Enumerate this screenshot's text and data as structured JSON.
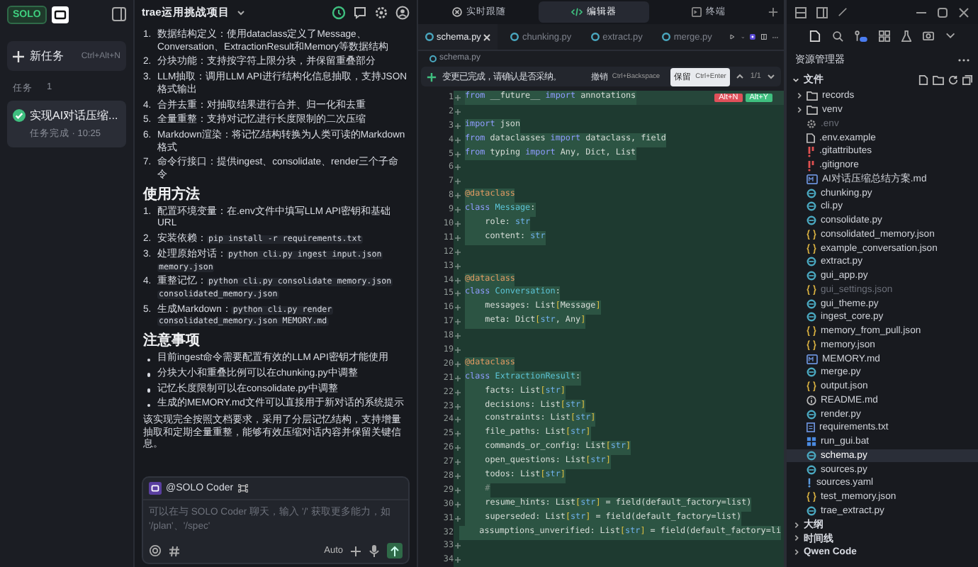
{
  "sidebar": {
    "logo": "SOLO",
    "new_task": {
      "label": "新任务",
      "shortcut": "Ctrl+Alt+N"
    },
    "tasks_label": "任务",
    "tasks_count": "1",
    "tasks": [
      {
        "title": "实现AI对话压缩...",
        "status": "任务完成 · 10:25",
        "done": true,
        "selected": true
      }
    ]
  },
  "chat": {
    "title": "trae运用挑战项目",
    "blocks": [
      {
        "kind": "ol",
        "items": [
          {
            "num": "1.",
            "text": "数据结构定义：使用dataclass定义了Message、Conversation、ExtractionResult和Memory等数据结构"
          },
          {
            "num": "2.",
            "text": "分块功能：支持按字符上限分块，并保留重叠部分"
          },
          {
            "num": "3.",
            "text": "LLM抽取：调用LLM API进行结构化信息抽取，支持JSON格式输出"
          },
          {
            "num": "4.",
            "text": "合并去重：对抽取结果进行合并、归一化和去重"
          },
          {
            "num": "5.",
            "text": "全量重整：支持对记忆进行长度限制的二次压缩"
          },
          {
            "num": "6.",
            "text": "Markdown渲染：将记忆结构转换为人类可读的Markdown格式"
          },
          {
            "num": "7.",
            "text": "命令行接口：提供ingest、consolidate、render三个子命令"
          }
        ]
      },
      {
        "kind": "heading",
        "text": "使用方法"
      },
      {
        "kind": "ol",
        "items": [
          {
            "num": "1.",
            "text": "配置环境变量：在.env文件中填写LLM API密钥和基础URL"
          },
          {
            "num": "2.",
            "text": "安装依赖：",
            "code": [
              "pip install -r requirements.txt"
            ]
          },
          {
            "num": "3.",
            "text": "处理原始对话：",
            "code": [
              "python cli.py ingest input.json",
              "memory.json"
            ]
          },
          {
            "num": "4.",
            "text": "重整记忆：",
            "code": [
              "python cli.py consolidate memory.json",
              "consolidated_memory.json"
            ]
          },
          {
            "num": "5.",
            "text": "生成Markdown：",
            "code": [
              "python cli.py render",
              "consolidated_memory.json MEMORY.md"
            ]
          }
        ]
      },
      {
        "kind": "heading",
        "text": "注意事项"
      },
      {
        "kind": "ul",
        "items": [
          {
            "text": "目前ingest命令需要配置有效的LLM API密钥才能使用"
          },
          {
            "text": "分块大小和重叠比例可以在chunking.py中调整"
          },
          {
            "text": "记忆长度限制可以在consolidate.py中调整"
          },
          {
            "text": "生成的MEMORY.md文件可以直接用于新对话的系统提示"
          }
        ]
      },
      {
        "kind": "p",
        "text": "该实现完全按照文档要求，采用了分层记忆结构，支持增量抽取和定期全量重整，能够有效压缩对话内容并保留关键信息。"
      }
    ],
    "input": {
      "mention": "@SOLO Coder",
      "placeholder": "可以在与 SOLO Coder 聊天，输入 '/' 获取更多能力，如 '/plan'、'/spec'",
      "mode": "Auto"
    }
  },
  "editor": {
    "views": [
      {
        "label": "实时跟随",
        "kind": "follow",
        "selected": false
      },
      {
        "label": "编辑器",
        "kind": "editor",
        "selected": true
      },
      {
        "label": "终端",
        "kind": "terminal",
        "selected": false
      }
    ],
    "tabs": [
      {
        "label": "schema.py",
        "selected": true
      },
      {
        "label": "chunking.py",
        "selected": false
      },
      {
        "label": "extract.py",
        "selected": false
      },
      {
        "label": "merge.py",
        "selected": false
      }
    ],
    "breadcrumb": "schema.py",
    "diff_bar": {
      "message": "变更已完成，请确认是否采纳。",
      "actions": [
        {
          "label": "撤销",
          "shortcut": "Ctrl+Backspace",
          "primary": false
        },
        {
          "label": "保留",
          "shortcut": "Ctrl+Enter",
          "primary": true
        }
      ],
      "counter": "1/1"
    },
    "line_keys": [
      {
        "label": "Alt+N",
        "kind": "reject"
      },
      {
        "label": "Alt+Y",
        "kind": "accept"
      }
    ],
    "lines": [
      {
        "n": "1",
        "tokens": [
          {
            "kind": "kw",
            "text": "from"
          },
          {
            "kind": "pl",
            "text": " __future__ "
          },
          {
            "kind": "kw",
            "text": "import"
          },
          {
            "kind": "pl",
            "text": " annotations"
          }
        ]
      },
      {
        "n": "2"
      },
      {
        "n": "3",
        "tokens": [
          {
            "kind": "kw",
            "text": "import"
          },
          {
            "kind": "pl",
            "text": " json"
          }
        ]
      },
      {
        "n": "4",
        "tokens": [
          {
            "kind": "kw",
            "text": "from"
          },
          {
            "kind": "pl",
            "text": " dataclasses "
          },
          {
            "kind": "kw",
            "text": "import"
          },
          {
            "kind": "pl",
            "text": " dataclass, field"
          }
        ]
      },
      {
        "n": "5",
        "tokens": [
          {
            "kind": "kw",
            "text": "from"
          },
          {
            "kind": "pl",
            "text": " typing "
          },
          {
            "kind": "kw",
            "text": "import"
          },
          {
            "kind": "pl",
            "text": " Any, Dict, List"
          }
        ]
      },
      {
        "n": "6"
      },
      {
        "n": "7"
      },
      {
        "n": "8",
        "tokens": [
          {
            "kind": "dec",
            "text": "@dataclass"
          }
        ]
      },
      {
        "n": "9",
        "tokens": [
          {
            "kind": "kw",
            "text": "class"
          },
          {
            "kind": "cls",
            "text": " Message"
          },
          {
            "kind": "pl",
            "text": ":"
          }
        ]
      },
      {
        "n": "10",
        "tokens": [
          {
            "kind": "pl",
            "text": "    role: "
          },
          {
            "kind": "bi",
            "text": "str"
          }
        ]
      },
      {
        "n": "11",
        "tokens": [
          {
            "kind": "pl",
            "text": "    content: "
          },
          {
            "kind": "bi",
            "text": "str"
          }
        ]
      },
      {
        "n": "12"
      },
      {
        "n": "13"
      },
      {
        "n": "14",
        "tokens": [
          {
            "kind": "dec",
            "text": "@dataclass"
          }
        ]
      },
      {
        "n": "15",
        "tokens": [
          {
            "kind": "kw",
            "text": "class"
          },
          {
            "kind": "cls",
            "text": " Conversation"
          },
          {
            "kind": "pl",
            "text": ":"
          }
        ]
      },
      {
        "n": "16",
        "tokens": [
          {
            "kind": "pl",
            "text": "    messages: List"
          },
          {
            "kind": "br",
            "text": "["
          },
          {
            "kind": "pl",
            "text": "Message"
          },
          {
            "kind": "br",
            "text": "]"
          }
        ]
      },
      {
        "n": "17",
        "tokens": [
          {
            "kind": "pl",
            "text": "    meta: Dict"
          },
          {
            "kind": "br",
            "text": "["
          },
          {
            "kind": "bi",
            "text": "str"
          },
          {
            "kind": "pl",
            "text": ", Any"
          },
          {
            "kind": "br",
            "text": "]"
          }
        ]
      },
      {
        "n": "18"
      },
      {
        "n": "19"
      },
      {
        "n": "20",
        "tokens": [
          {
            "kind": "dec",
            "text": "@dataclass"
          }
        ]
      },
      {
        "n": "21",
        "tokens": [
          {
            "kind": "kw",
            "text": "class"
          },
          {
            "kind": "cls",
            "text": " ExtractionResult"
          },
          {
            "kind": "pl",
            "text": ":"
          }
        ]
      },
      {
        "n": "22",
        "tokens": [
          {
            "kind": "pl",
            "text": "    facts: List"
          },
          {
            "kind": "br",
            "text": "["
          },
          {
            "kind": "bi",
            "text": "str"
          },
          {
            "kind": "br",
            "text": "]"
          }
        ]
      },
      {
        "n": "23",
        "tokens": [
          {
            "kind": "pl",
            "text": "    decisions: List"
          },
          {
            "kind": "br",
            "text": "["
          },
          {
            "kind": "bi",
            "text": "str"
          },
          {
            "kind": "br",
            "text": "]"
          }
        ]
      },
      {
        "n": "24",
        "tokens": [
          {
            "kind": "pl",
            "text": "    constraints: List"
          },
          {
            "kind": "br",
            "text": "["
          },
          {
            "kind": "bi",
            "text": "str"
          },
          {
            "kind": "br",
            "text": "]"
          }
        ]
      },
      {
        "n": "25",
        "tokens": [
          {
            "kind": "pl",
            "text": "    file_paths: List"
          },
          {
            "kind": "br",
            "text": "["
          },
          {
            "kind": "bi",
            "text": "str"
          },
          {
            "kind": "br",
            "text": "]"
          }
        ]
      },
      {
        "n": "26",
        "tokens": [
          {
            "kind": "pl",
            "text": "    commands_or_config: List"
          },
          {
            "kind": "br",
            "text": "["
          },
          {
            "kind": "bi",
            "text": "str"
          },
          {
            "kind": "br",
            "text": "]"
          }
        ]
      },
      {
        "n": "27",
        "tokens": [
          {
            "kind": "pl",
            "text": "    open_questions: List"
          },
          {
            "kind": "br",
            "text": "["
          },
          {
            "kind": "bi",
            "text": "str"
          },
          {
            "kind": "br",
            "text": "]"
          }
        ]
      },
      {
        "n": "28",
        "tokens": [
          {
            "kind": "pl",
            "text": "    todos: List"
          },
          {
            "kind": "br",
            "text": "["
          },
          {
            "kind": "bi",
            "text": "str"
          },
          {
            "kind": "br",
            "text": "]"
          }
        ]
      },
      {
        "n": "29",
        "tokens": [
          {
            "kind": "cm",
            "text": "    #"
          }
        ]
      },
      {
        "n": "30",
        "tokens": [
          {
            "kind": "pl",
            "text": "    resume_hints: List"
          },
          {
            "kind": "br",
            "text": "["
          },
          {
            "kind": "bi",
            "text": "str"
          },
          {
            "kind": "br",
            "text": "]"
          },
          {
            "kind": "pl",
            "text": " = field(default_factory=list)"
          }
        ]
      },
      {
        "n": "31",
        "tokens": [
          {
            "kind": "pl",
            "text": "    superseded: List"
          },
          {
            "kind": "br",
            "text": "["
          },
          {
            "kind": "bi",
            "text": "str"
          },
          {
            "kind": "br",
            "text": "]"
          },
          {
            "kind": "pl",
            "text": " = field(default_factory=list)"
          }
        ]
      },
      {
        "n": "32",
        "tokens": [
          {
            "kind": "pl",
            "text": "    assumptions_unverified: List"
          },
          {
            "kind": "br",
            "text": "["
          },
          {
            "kind": "bi",
            "text": "str"
          },
          {
            "kind": "br",
            "text": "]"
          },
          {
            "kind": "pl",
            "text": " = field(default_factory=li"
          }
        ]
      },
      {
        "n": "33"
      },
      {
        "n": "34"
      }
    ]
  },
  "explorer": {
    "title": "资源管理器",
    "root": "文件",
    "items": [
      {
        "name": "records",
        "kind": "folder",
        "expanded": false,
        "dimmed": false,
        "selected": false
      },
      {
        "name": "venv",
        "kind": "folder",
        "expanded": false,
        "dimmed": false,
        "selected": false
      },
      {
        "name": ".env",
        "kind": "env",
        "dimmed": true,
        "selected": false
      },
      {
        "name": ".env.example",
        "kind": "file",
        "dimmed": false,
        "selected": false
      },
      {
        "name": ".gitattributes",
        "kind": "git",
        "dimmed": false,
        "selected": false
      },
      {
        "name": ".gitignore",
        "kind": "git",
        "dimmed": false,
        "selected": false
      },
      {
        "name": "AI对话压缩总结方案.md",
        "kind": "md",
        "dimmed": false,
        "selected": false
      },
      {
        "name": "chunking.py",
        "kind": "py",
        "dimmed": false,
        "selected": false
      },
      {
        "name": "cli.py",
        "kind": "py",
        "dimmed": false,
        "selected": false
      },
      {
        "name": "consolidate.py",
        "kind": "py",
        "dimmed": false,
        "selected": false
      },
      {
        "name": "consolidated_memory.json",
        "kind": "json",
        "dimmed": false,
        "selected": false
      },
      {
        "name": "example_conversation.json",
        "kind": "json",
        "dimmed": false,
        "selected": false
      },
      {
        "name": "extract.py",
        "kind": "py",
        "dimmed": false,
        "selected": false
      },
      {
        "name": "gui_app.py",
        "kind": "py",
        "dimmed": false,
        "selected": false
      },
      {
        "name": "gui_settings.json",
        "kind": "json",
        "dimmed": true,
        "selected": false
      },
      {
        "name": "gui_theme.py",
        "kind": "py",
        "dimmed": false,
        "selected": false
      },
      {
        "name": "ingest_core.py",
        "kind": "py",
        "dimmed": false,
        "selected": false
      },
      {
        "name": "memory_from_pull.json",
        "kind": "json",
        "dimmed": false,
        "selected": false
      },
      {
        "name": "memory.json",
        "kind": "json",
        "dimmed": false,
        "selected": false
      },
      {
        "name": "MEMORY.md",
        "kind": "md",
        "dimmed": false,
        "selected": false
      },
      {
        "name": "merge.py",
        "kind": "py",
        "dimmed": false,
        "selected": false
      },
      {
        "name": "output.json",
        "kind": "json",
        "dimmed": false,
        "selected": false
      },
      {
        "name": "README.md",
        "kind": "info",
        "dimmed": false,
        "selected": false
      },
      {
        "name": "render.py",
        "kind": "py",
        "dimmed": false,
        "selected": false
      },
      {
        "name": "requirements.txt",
        "kind": "txt",
        "dimmed": false,
        "selected": false
      },
      {
        "name": "run_gui.bat",
        "kind": "bat",
        "dimmed": false,
        "selected": false
      },
      {
        "name": "schema.py",
        "kind": "py",
        "dimmed": false,
        "selected": true
      },
      {
        "name": "sources.py",
        "kind": "py",
        "dimmed": false,
        "selected": false
      },
      {
        "name": "sources.yaml",
        "kind": "yaml",
        "dimmed": false,
        "selected": false
      },
      {
        "name": "test_memory.json",
        "kind": "json",
        "dimmed": false,
        "selected": false
      },
      {
        "name": "trae_extract.py",
        "kind": "py",
        "dimmed": false,
        "selected": false
      }
    ],
    "sections": [
      {
        "label": "大纲",
        "expanded": false
      },
      {
        "label": "时间线",
        "expanded": false
      },
      {
        "label": "Qwen Code",
        "expanded": false
      }
    ]
  }
}
